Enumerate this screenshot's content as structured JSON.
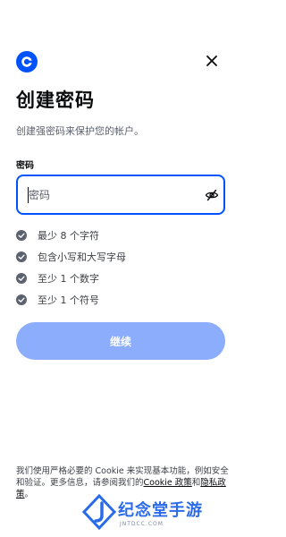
{
  "header": {
    "logo_icon": "coinbase-logo-icon",
    "close_icon": "close-icon"
  },
  "title": "创建密码",
  "subtitle": "创建强密码来保护您的帐户。",
  "password": {
    "label": "密码",
    "placeholder": "密码",
    "value": "",
    "toggle_icon": "eye-off-icon"
  },
  "requirements": [
    {
      "label": "最少 8 个字符",
      "icon": "check-circle-icon"
    },
    {
      "label": "包含小写和大写字母",
      "icon": "check-circle-icon"
    },
    {
      "label": "至少 1 个数字",
      "icon": "check-circle-icon"
    },
    {
      "label": "至少 1 个符号",
      "icon": "check-circle-icon"
    }
  ],
  "continue_button": "继续",
  "footer": {
    "text_before": "我们使用严格必要的 Cookie 来实现基本功能，例如安全和验证。更多信息，请参阅我们的",
    "cookie_link": "Cookie 政策",
    "and": "和",
    "privacy_link": "隐私政策",
    "end": "。"
  },
  "watermark": {
    "text": "纪念堂手游",
    "sub": "JNTDCC.COM"
  },
  "colors": {
    "brand": "#0052ff",
    "button_disabled": "#8cadfb",
    "text": "#0a0b0d",
    "muted": "#5b616e"
  }
}
